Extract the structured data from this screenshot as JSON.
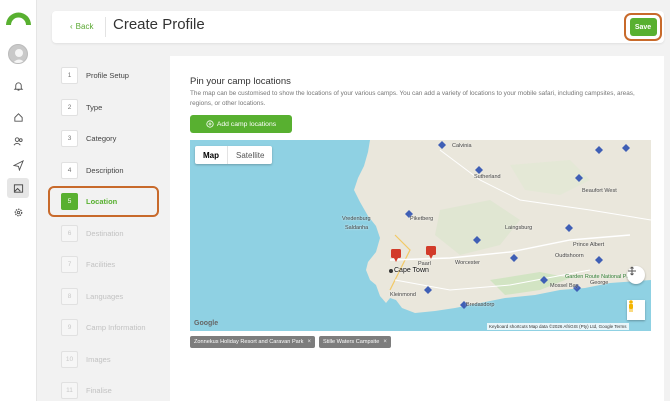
{
  "header": {
    "back_label": "Back",
    "title": "Create Profile",
    "save_label": "Save"
  },
  "steps": [
    {
      "num": "1",
      "label": "Profile Setup",
      "state": "done"
    },
    {
      "num": "2",
      "label": "Type",
      "state": "done"
    },
    {
      "num": "3",
      "label": "Category",
      "state": "done"
    },
    {
      "num": "4",
      "label": "Description",
      "state": "done"
    },
    {
      "num": "5",
      "label": "Location",
      "state": "active"
    },
    {
      "num": "6",
      "label": "Destination",
      "state": "disabled"
    },
    {
      "num": "7",
      "label": "Facilities",
      "state": "disabled"
    },
    {
      "num": "8",
      "label": "Languages",
      "state": "disabled"
    },
    {
      "num": "9",
      "label": "Camp Information",
      "state": "disabled"
    },
    {
      "num": "10",
      "label": "Images",
      "state": "disabled"
    },
    {
      "num": "11",
      "label": "Finalise",
      "state": "disabled"
    }
  ],
  "main": {
    "title": "Pin your camp locations",
    "description": "The map can be customised to show the locations of your various camps. You can add a variety of locations to your mobile safari, including campsites, areas, regions, or other locations.",
    "add_button": "Add camp locations"
  },
  "map": {
    "tabs": [
      "Map",
      "Satellite"
    ],
    "labels": {
      "calvinia": "Calvinia",
      "sutherland": "Sutherland",
      "laingsburg": "Laingsburg",
      "beaufort_west": "Beaufort West",
      "prince_albert": "Prince Albert",
      "vredenburg": "Vredenburg",
      "saldanha": "Saldanha",
      "piketberg": "Piketberg",
      "worcester": "Worcester",
      "paarl": "Paarl",
      "cape_town": "Cape Town",
      "oudtshoorn": "Oudtshoorn",
      "george": "George",
      "mossel_bay": "Mossel Bay",
      "bredasdorp": "Bredasdorp",
      "kleinmond": "Kleinmond",
      "garden_route": "Garden Route National Park"
    },
    "google": "Google",
    "attribution": "Keyboard shortcuts   Map data ©2026 AfriGIS (Pty) Ltd, Google   Terms"
  },
  "chips": [
    {
      "label": "Zonnekus Holiday Resort and Caravan Park"
    },
    {
      "label": "Stille Waters Campsite"
    }
  ],
  "colors": {
    "accent": "#58b030",
    "highlight": "#c86a2b",
    "water": "#8fd1e3"
  }
}
